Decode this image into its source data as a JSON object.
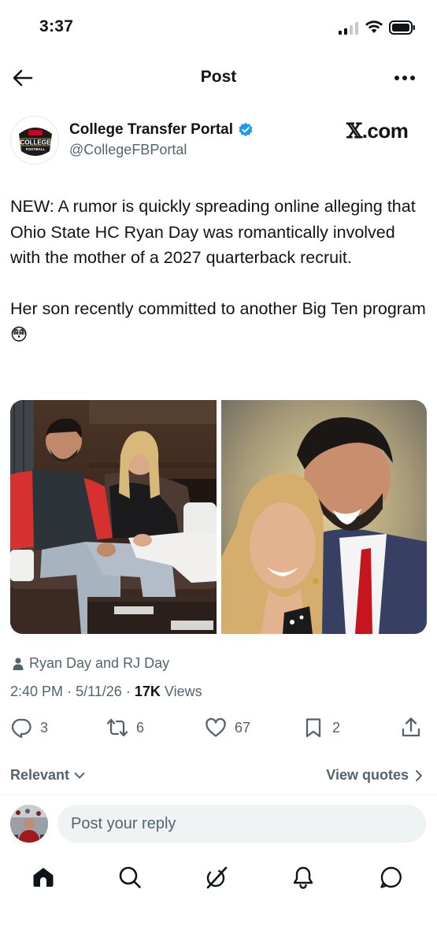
{
  "status_bar": {
    "time": "3:37"
  },
  "nav": {
    "title": "Post"
  },
  "author": {
    "name": "College Transfer Portal",
    "handle": "@CollegeFBPortal",
    "avatar_text": "COLLEGE",
    "avatar_subtext": "FOOTBALL"
  },
  "watermark": {
    "x": "𝕏",
    "rest": ".com"
  },
  "post": {
    "text": "NEW: A rumor is quickly spreading online alleging that Ohio State HC Ryan Day was romantically involved with the mother of a 2027 quarterback recruit.\n\nHer son recently committed to another Big Ten program 😳"
  },
  "tagged": {
    "text": "Ryan Day and RJ Day"
  },
  "meta": {
    "time": "2:40 PM",
    "date": "5/11/26",
    "views_count": "17K",
    "views_label": "Views",
    "sep": "·"
  },
  "actions": {
    "replies": "3",
    "reposts": "6",
    "likes": "67",
    "bookmarks": "2"
  },
  "sort": {
    "relevant": "Relevant",
    "view_quotes": "View quotes"
  },
  "reply": {
    "placeholder": "Post your reply"
  },
  "colors": {
    "verified": "#1d9bf0",
    "secondary_text": "#536471",
    "text": "#0f1419"
  },
  "icons": {
    "back": "arrow-left-icon",
    "more": "more-horizontal-icon",
    "verified": "verified-badge-icon",
    "person": "person-icon",
    "reply": "reply-icon",
    "repost": "repost-icon",
    "like": "heart-icon",
    "bookmark": "bookmark-icon",
    "share": "share-icon",
    "home": "home-icon",
    "search": "search-icon",
    "grok": "grok-icon",
    "notifications": "bell-icon",
    "messages": "message-icon"
  }
}
